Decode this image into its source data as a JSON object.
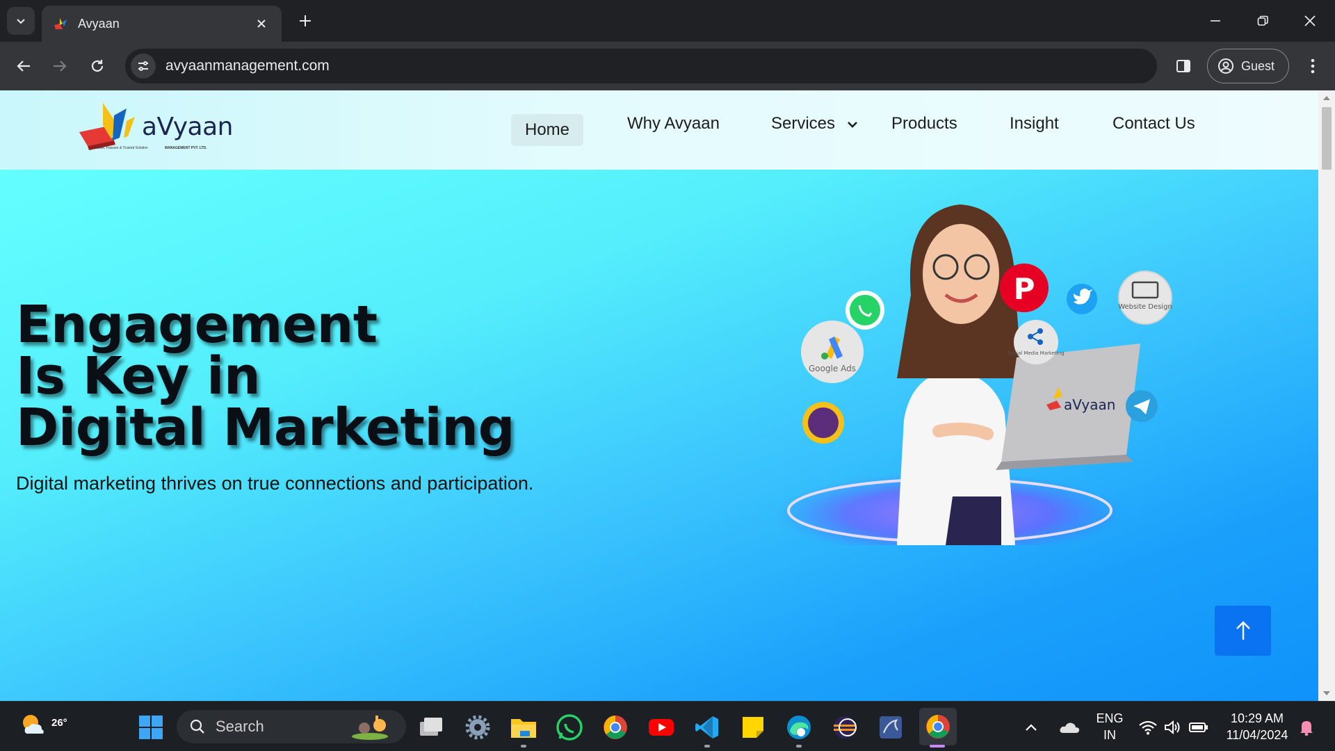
{
  "browser": {
    "tab_title": "Avyaan",
    "url": "avyaanmanagement.com",
    "profile_label": "Guest"
  },
  "site": {
    "logo_text": "aVyaan",
    "logo_tagline": "Power, Passion & Trusted Solution",
    "logo_sub": "MANAGEMENT PVT. LTD.",
    "nav": {
      "home": "Home",
      "why": "Why Avyaan",
      "services": "Services",
      "products": "Products",
      "insight": "Insight",
      "contact": "Contact Us"
    },
    "hero": {
      "title_line1": "Engagement",
      "title_line2": "Is Key in",
      "title_line3": "Digital Marketing",
      "subtitle": "Digital marketing thrives on true connections and participation.",
      "art_labels": {
        "google_ads": "Google Ads",
        "website_design": "Website Design",
        "social_media": "Social Media Marketing",
        "laptop_logo": "aVyaan"
      }
    }
  },
  "taskbar": {
    "weather_temp": "26°",
    "search_placeholder": "Search",
    "lang_line1": "ENG",
    "lang_line2": "IN",
    "time": "10:29 AM",
    "date": "11/04/2024"
  },
  "colors": {
    "accent_blue": "#0a73f2",
    "hero_top": "#63ffff",
    "hero_bottom": "#0f92fa",
    "header_bg": "#e4fbfd"
  }
}
